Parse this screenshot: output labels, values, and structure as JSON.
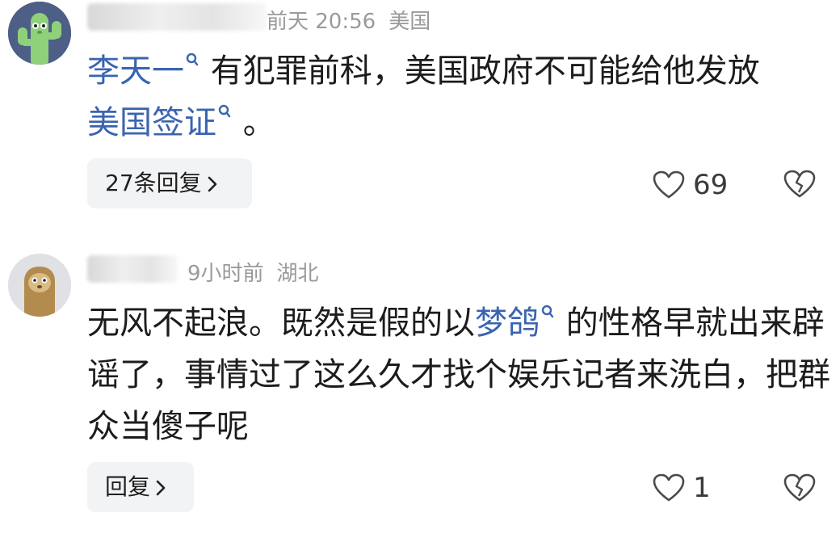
{
  "comments": [
    {
      "time": "前天 20:56",
      "location": "美国",
      "text_parts": {
        "kw1": "李天一",
        "t1": " 有犯罪前科，美国政府不可能给他发放",
        "kw2": "美国签证",
        "t2": " 。"
      },
      "reply_label": "27条回复",
      "like_count": "69",
      "avatar_icon": "cactus-avatar-icon"
    },
    {
      "time": "9小时前",
      "location": "湖北",
      "text_parts": {
        "t1": "无风不起浪。既然是假的以",
        "kw1": "梦鸽",
        "t2": " 的性格早就出来辟谣了，事情过了这么久才找个娱乐记者来洗白，把群众当傻子呢"
      },
      "reply_label": "回复",
      "like_count": "1",
      "avatar_icon": "sloth-avatar-icon"
    }
  ],
  "colors": {
    "keyword": "#3a64b0",
    "meta": "#9a9a9a",
    "reply_bg": "#f2f3f5"
  }
}
